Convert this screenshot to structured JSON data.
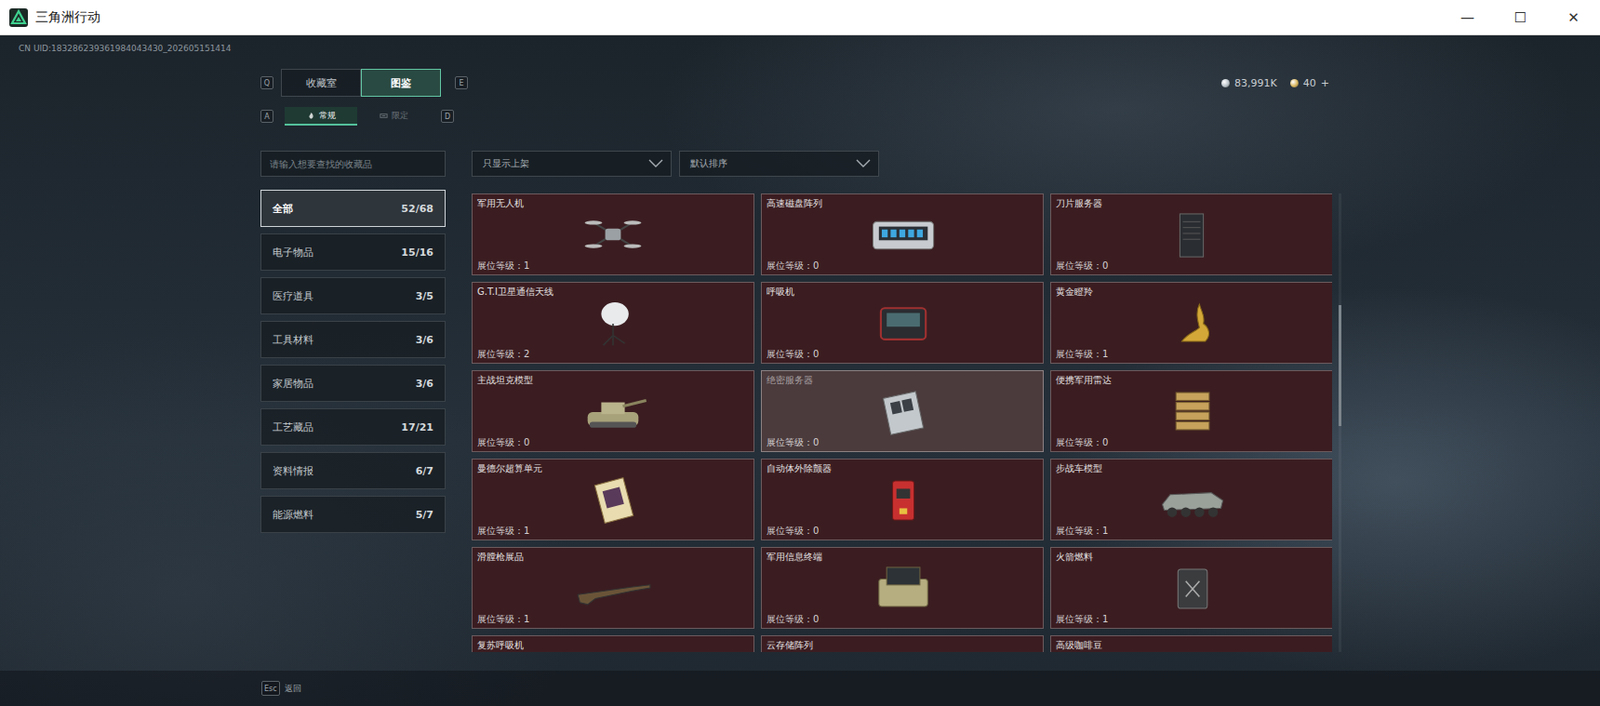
{
  "window": {
    "title": "三角洲行动",
    "controls": [
      "—",
      "☐",
      "✕"
    ]
  },
  "uid": "CN UID:183286239361984043430_202605151414",
  "currency": [
    {
      "amount": "83,991K",
      "color": "#b9c2c8"
    },
    {
      "amount": "40",
      "action": "+",
      "color": "#d7b45a"
    }
  ],
  "tabs": {
    "prev_key": "Q",
    "next_key": "E",
    "items": [
      {
        "label": "收藏室",
        "selected": false
      },
      {
        "label": "图鉴",
        "selected": true
      }
    ]
  },
  "subtabs": {
    "prev_key": "A",
    "next_key": "D",
    "items": [
      {
        "label": "常规",
        "selected": true
      },
      {
        "label": "限定",
        "selected": false
      }
    ]
  },
  "search": {
    "placeholder": "请输入想要查找的收藏品"
  },
  "filters": [
    {
      "label": "只显示上架"
    },
    {
      "label": "默认排序"
    }
  ],
  "categories": [
    {
      "name": "全部",
      "count": "52/68",
      "selected": true
    },
    {
      "name": "电子物品",
      "count": "15/16",
      "selected": false
    },
    {
      "name": "医疗道具",
      "count": "3/5",
      "selected": false
    },
    {
      "name": "工具材料",
      "count": "3/6",
      "selected": false
    },
    {
      "name": "家居物品",
      "count": "3/6",
      "selected": false
    },
    {
      "name": "工艺藏品",
      "count": "17/21",
      "selected": false
    },
    {
      "name": "资料情报",
      "count": "6/7",
      "selected": false
    },
    {
      "name": "能源燃料",
      "count": "5/7",
      "selected": false
    }
  ],
  "items": [
    {
      "name": "军用无人机",
      "booth": "展位等级：1",
      "highlighted": false
    },
    {
      "name": "高速磁盘阵列",
      "booth": "展位等级：0",
      "highlighted": false
    },
    {
      "name": "刀片服务器",
      "booth": "展位等级：0",
      "highlighted": false
    },
    {
      "name": "G.T.I卫星通信天线",
      "booth": "展位等级：2",
      "highlighted": false
    },
    {
      "name": "呼吸机",
      "booth": "展位等级：0",
      "highlighted": false
    },
    {
      "name": "黄金瞪羚",
      "booth": "展位等级：1",
      "highlighted": false
    },
    {
      "name": "主战坦克模型",
      "booth": "展位等级：0",
      "highlighted": false
    },
    {
      "name": "绝密服务器",
      "booth": "展位等级：0",
      "highlighted": true
    },
    {
      "name": "便携军用雷达",
      "booth": "展位等级：0",
      "highlighted": false
    },
    {
      "name": "曼德尔超算单元",
      "booth": "展位等级：1",
      "highlighted": false
    },
    {
      "name": "自动体外除颤器",
      "booth": "展位等级：0",
      "highlighted": false
    },
    {
      "name": "步战车模型",
      "booth": "展位等级：1",
      "highlighted": false
    },
    {
      "name": "滑膛枪展品",
      "booth": "展位等级：1",
      "highlighted": false
    },
    {
      "name": "军用信息终端",
      "booth": "展位等级：0",
      "highlighted": false
    },
    {
      "name": "火箭燃料",
      "booth": "展位等级：1",
      "highlighted": false
    },
    {
      "name": "复苏呼吸机",
      "highlighted": false
    },
    {
      "name": "云存储阵列",
      "highlighted": false
    },
    {
      "name": "高级咖啡豆",
      "highlighted": false
    }
  ],
  "footer": {
    "key": "Esc",
    "label": "返回"
  }
}
